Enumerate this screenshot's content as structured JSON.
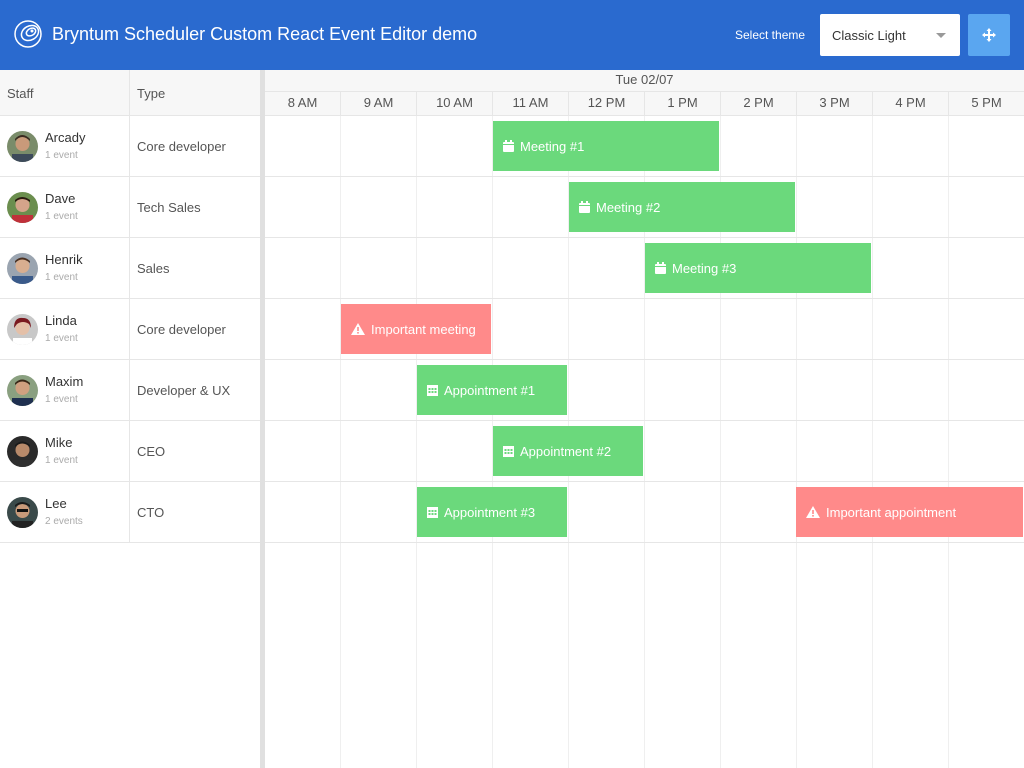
{
  "header": {
    "title": "Bryntum Scheduler Custom React Event Editor demo",
    "theme_label": "Select theme",
    "theme_value": "Classic Light"
  },
  "grid": {
    "columns": [
      "Staff",
      "Type"
    ],
    "rows": [
      {
        "name": "Arcady",
        "count": "1 event",
        "type": "Core developer"
      },
      {
        "name": "Dave",
        "count": "1 event",
        "type": "Tech Sales"
      },
      {
        "name": "Henrik",
        "count": "1 event",
        "type": "Sales"
      },
      {
        "name": "Linda",
        "count": "1 event",
        "type": "Core developer"
      },
      {
        "name": "Maxim",
        "count": "1 event",
        "type": "Developer & UX"
      },
      {
        "name": "Mike",
        "count": "1 event",
        "type": "CEO"
      },
      {
        "name": "Lee",
        "count": "2 events",
        "type": "CTO"
      }
    ]
  },
  "timeline": {
    "date": "Tue 02/07",
    "hours": [
      "8 AM",
      "9 AM",
      "10 AM",
      "11 AM",
      "12 PM",
      "1 PM",
      "2 PM",
      "3 PM",
      "4 PM",
      "5 PM"
    ]
  },
  "events": [
    {
      "name": "Meeting #1",
      "resource": "Arcady",
      "start": "11 AM",
      "end": "2 PM",
      "icon": "calendar-icon",
      "color": "#6bd97c"
    },
    {
      "name": "Meeting #2",
      "resource": "Dave",
      "start": "12 PM",
      "end": "3 PM",
      "icon": "calendar-icon",
      "color": "#6bd97c"
    },
    {
      "name": "Meeting #3",
      "resource": "Henrik",
      "start": "1 PM",
      "end": "4 PM",
      "icon": "calendar-icon",
      "color": "#6bd97c"
    },
    {
      "name": "Important meeting",
      "resource": "Linda",
      "start": "9 AM",
      "end": "11 AM",
      "icon": "warning-icon",
      "color": "#ff8a8a"
    },
    {
      "name": "Appointment #1",
      "resource": "Maxim",
      "start": "10 AM",
      "end": "12 PM",
      "icon": "calendar-grid-icon",
      "color": "#6bd97c"
    },
    {
      "name": "Appointment #2",
      "resource": "Mike",
      "start": "11 AM",
      "end": "1 PM",
      "icon": "calendar-grid-icon",
      "color": "#6bd97c"
    },
    {
      "name": "Appointment #3",
      "resource": "Lee",
      "start": "10 AM",
      "end": "12 PM",
      "icon": "calendar-grid-icon",
      "color": "#6bd97c"
    },
    {
      "name": "Important appointment",
      "resource": "Lee",
      "start": "3 PM",
      "end": "6 PM",
      "icon": "warning-icon",
      "color": "#ff8a8a"
    }
  ],
  "colors": {
    "header": "#2a6acf",
    "accent": "#5aa6f0",
    "event_green": "#6bd97c",
    "event_red": "#ff8a8a"
  }
}
